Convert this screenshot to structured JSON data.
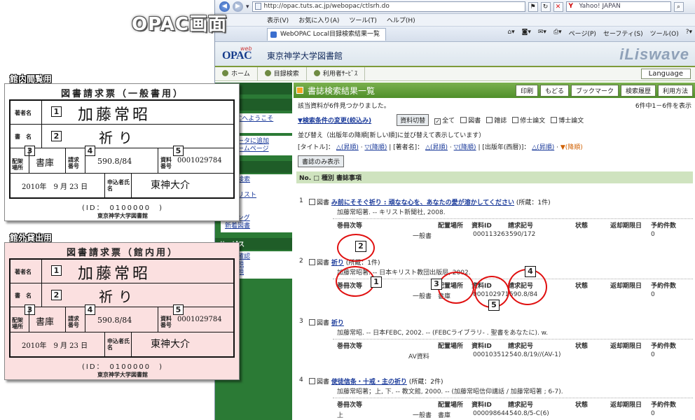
{
  "overlay_title": "OPAC画面",
  "captions": {
    "inhouse": "館内閲覧用",
    "outside": "館外貸出用"
  },
  "browser": {
    "url": "http://opac.tuts.ac.jp/webopac/ctlsrh.do",
    "search_placeholder": "Yahoo! JAPAN",
    "menu": [
      "表示(V)",
      "お気に入り(A)",
      "ツール(T)",
      "ヘルプ(H)"
    ],
    "tab_title": "WebOPAC Local目録検索結果一覧",
    "commands": [
      "ページ(P)",
      "セーフティ(S)",
      "ツール(O)"
    ]
  },
  "opac": {
    "logo_small": "web",
    "logo": "OPAC",
    "library_name": "東京神学大学図書館",
    "brand": "iLiswave",
    "nav": [
      "ホーム",
      "目録検索",
      "利用者ｻｰﾋﾞｽ"
    ],
    "language_button": "Language",
    "left": {
      "head1": "ュー",
      "head_inside": "内",
      "link1": "OPACへようこそ",
      "link1b": "手引",
      "link2": "ラレータに追加",
      "link2b": "館ホームページ",
      "head_search": "索",
      "items": [
        "ード検索",
        "検索",
        "検索リスト",
        "検索",
        "検索",
        "ンキング",
        "新着図書"
      ],
      "head_service": "サービス",
      "service_items": [
        "況の確認",
        "入依頼",
        "写依頼"
      ]
    },
    "result_title": "書誌検索結果一覧",
    "buttons": [
      "印刷",
      "もどる",
      "ブックマーク",
      "検索履歴",
      "利用方法"
    ],
    "count_text": "該当資料が6件見つかりました。",
    "range_text": "6件中1－6件を表示",
    "cond_link": "▼検索条件の変更(絞込み)",
    "filter_button": "資料切替",
    "filters": [
      "全て",
      "図書",
      "雑誌",
      "修士論文",
      "博士論文"
    ],
    "sort_text": "並び替え（出版年の降順[新しい順]に並び替えて表示しています）",
    "sort_title": "[タイトル]：",
    "sort_author": "[著者名]：",
    "sort_year": "[出版年(西暦)]：",
    "asc": "△(昇順)",
    "desc": "▽(降順)",
    "desc_active": "▼(降順)",
    "title_only_button": "書誌のみ表示",
    "list_header": "No. □ 種別 書誌事項",
    "hold_cols": [
      "巻冊次等",
      "配置場所",
      "資料ID",
      "請求記号",
      "状態",
      "返却期限日",
      "予約件数"
    ],
    "records": [
      {
        "num": "1",
        "type": "図書",
        "title": "み前にそそぐ祈り : 頑なな心を、あなたの愛が溶かしてください",
        "count": "(所蔵：1件)",
        "pub": "加藤常昭著. -- キリスト新聞社, 2008.",
        "rows": [
          [
            "",
            "一般書",
            "000113263",
            "590/172",
            "",
            "",
            "0"
          ]
        ]
      },
      {
        "num": "2",
        "type": "図書",
        "title": "祈り",
        "count": "(所蔵：1件)",
        "pub": "加藤常昭著. -- 日本キリスト教団出版局, 2002.",
        "rows": [
          [
            "",
            "一般書",
            "000102971",
            "590.8/84",
            "",
            "",
            "0"
          ]
        ]
      },
      {
        "num": "3",
        "type": "図書",
        "title": "祈り",
        "count": "",
        "pub": "加藤常昭. -- 日本FEBC, 2002. -- (FEBCライブラリ- . 聖書をあなたに). w.",
        "rows": [
          [
            "",
            "AV資料",
            "000103512",
            "540.8/19//(AV-1)",
            "",
            "",
            "0"
          ]
        ]
      },
      {
        "num": "4",
        "type": "図書",
        "title": "使徒信条・十戒・主の祈り",
        "count": "(所蔵：2件)",
        "pub": "加藤常昭著；上, 下. -- 教文館, 2000. -- (加藤常昭信仰講話 / 加藤常昭著 ; 6-7).",
        "rows": [
          [
            "上",
            "一般書",
            "000098644",
            "540.8/5-C(6)",
            "",
            "",
            "0"
          ]
        ]
      }
    ]
  },
  "slip": {
    "title_general": "図書請求票（一般書用）",
    "title_library": "図書請求票（館内用）",
    "label_author": "著者名",
    "label_title": "書　名",
    "label_location": "配架場所",
    "label_callno": "請求番号",
    "label_materialid": "資料番号",
    "label_applicant": "申込者氏名",
    "author": "加藤常昭",
    "book_title": "祈り",
    "location": "書庫",
    "callno": "590.8/84",
    "material_id": "0001029784",
    "date": "2010年　9 月 23 日",
    "applicant": "東神大介",
    "id_line": "(ID：　0100000　)",
    "org": "東京神学大学図書館"
  },
  "markers": [
    "1",
    "2",
    "3",
    "4",
    "5"
  ]
}
